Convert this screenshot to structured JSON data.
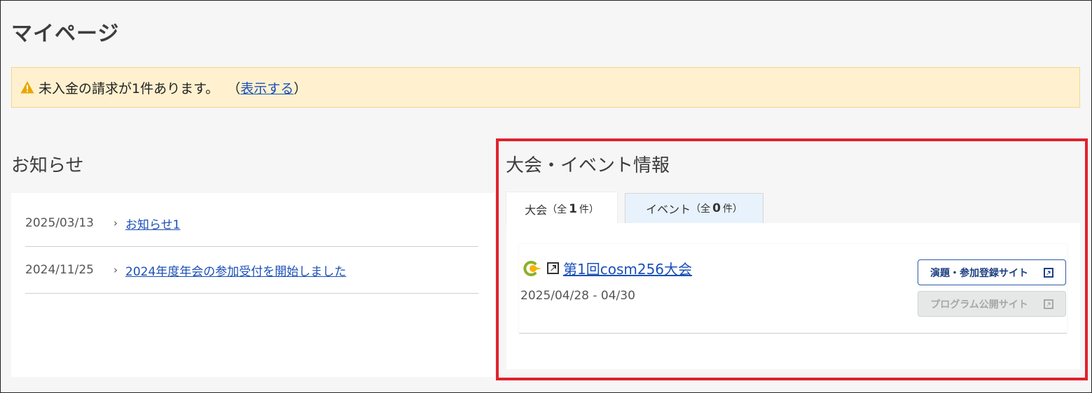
{
  "page": {
    "title": "マイページ"
  },
  "alert": {
    "icon": "warning-icon",
    "message": "未入金の請求が1件あります。",
    "paren_open": "（",
    "link_label": "表示する",
    "paren_close": "）"
  },
  "news": {
    "title": "お知らせ",
    "items": [
      {
        "date": "2025/03/13",
        "title": "お知らせ1"
      },
      {
        "date": "2024/11/25",
        "title": "2024年度年会の参加受付を開始しました"
      }
    ]
  },
  "events": {
    "title": "大会・イベント情報",
    "tabs": [
      {
        "label": "大会",
        "prefix": "（全",
        "count": "1",
        "suffix": "件）",
        "active": true
      },
      {
        "label": "イベント",
        "prefix": "（全",
        "count": "0",
        "suffix": "件）",
        "active": false
      }
    ],
    "card": {
      "name": "第1回cosm256大会",
      "date": "2025/04/28 - 04/30",
      "buttons": {
        "abstract": "演題・参加登録サイト",
        "program": "プログラム公開サイト"
      }
    }
  },
  "colors": {
    "highlight_frame": "#e0222e",
    "link": "#1a4fb8",
    "alert_bg": "#fff1cf",
    "event_tab_bg": "#e8f2fc"
  }
}
